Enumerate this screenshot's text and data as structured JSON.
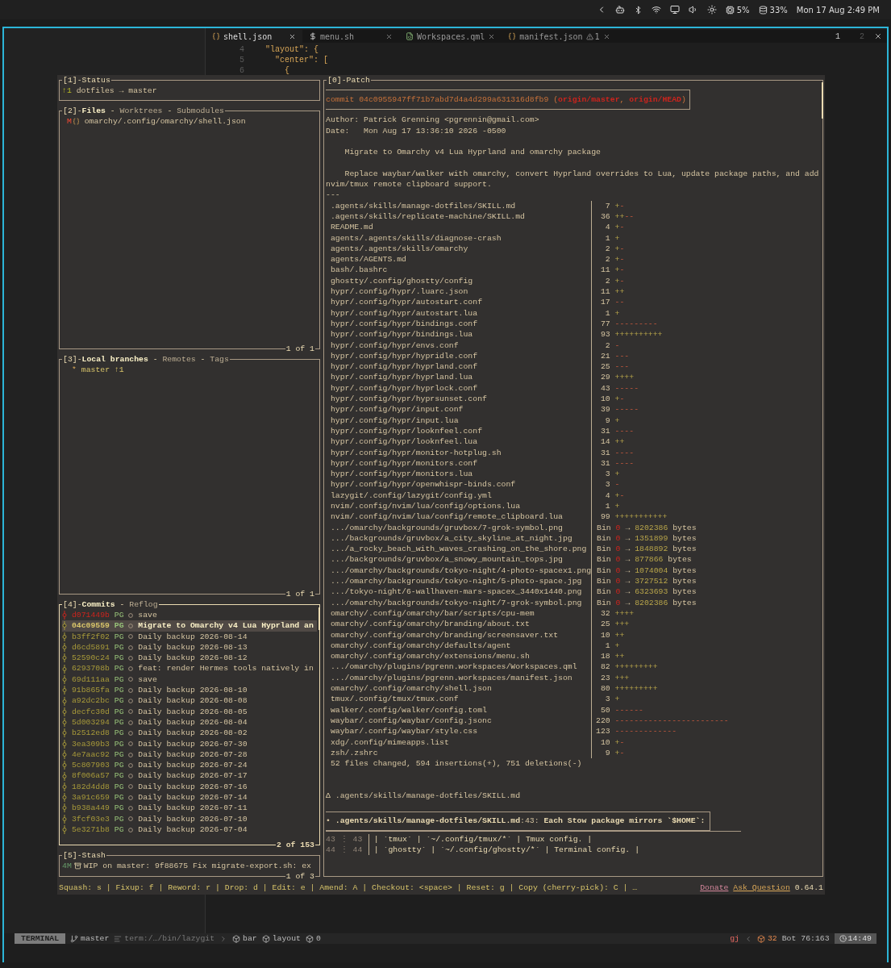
{
  "top_bar": {
    "cpu": "5%",
    "memory": "33%",
    "clock": "Mon 17 Aug 2:49 PM"
  },
  "editor": {
    "tabs": [
      {
        "label": "shell.json",
        "kind": "json",
        "selected": true
      },
      {
        "label": "menu.sh",
        "kind": "shell",
        "selected": false
      },
      {
        "label": "Workspaces.qml",
        "kind": "qml",
        "selected": false
      },
      {
        "label": "manifest.json",
        "kind": "json",
        "selected": false,
        "warnings": "1"
      }
    ],
    "tabpages": [
      {
        "label": "1",
        "selected": true
      },
      {
        "label": "2",
        "selected": false
      }
    ],
    "lines": [
      {
        "number": "4",
        "text": "  \"layout\": {"
      },
      {
        "number": "5",
        "text": "    \"center\": ["
      },
      {
        "number": "6",
        "text": "      {"
      }
    ]
  },
  "lazygit": {
    "status": {
      "title": "[1]-Status",
      "ahead": "↑1",
      "repo": "dotfiles → master"
    },
    "files": {
      "prefix": "[2]-",
      "separator": " - ",
      "tabs": [
        {
          "label": "Files",
          "selected": true
        },
        {
          "label": "Worktrees",
          "selected": false
        },
        {
          "label": "Submodules",
          "selected": false
        }
      ],
      "rows": [
        {
          "status": "M",
          "path": "omarchy/.config/omarchy/shell.json"
        }
      ],
      "footer": "1 of 1"
    },
    "branches": {
      "prefix": "[3]-",
      "separator": " - ",
      "tabs": [
        {
          "label": "Local branches",
          "selected": true
        },
        {
          "label": "Remotes",
          "selected": false
        },
        {
          "label": "Tags",
          "selected": false
        }
      ],
      "rows": [
        {
          "marker": "*",
          "name": "master",
          "ahead": "↑1"
        }
      ],
      "footer": "1 of 1"
    },
    "commits": {
      "prefix": "[4]-",
      "separator": " - ",
      "focused": true,
      "tabs": [
        {
          "label": "Commits",
          "selected": true
        },
        {
          "label": "Reflog",
          "selected": false
        }
      ],
      "rows": [
        {
          "hash": "d071449b",
          "author": "PG",
          "message": "save",
          "pushed": false,
          "selected": false
        },
        {
          "hash": "04c09559",
          "author": "PG",
          "message": "Migrate to Omarchy v4 Lua Hyprland an",
          "pushed": true,
          "selected": true
        },
        {
          "hash": "b3ff2f02",
          "author": "PG",
          "message": "Daily backup 2026-08-14",
          "pushed": true,
          "selected": false
        },
        {
          "hash": "d6cd5891",
          "author": "PG",
          "message": "Daily backup 2026-08-13",
          "pushed": true,
          "selected": false
        },
        {
          "hash": "52590c24",
          "author": "PG",
          "message": "Daily backup 2026-08-12",
          "pushed": true,
          "selected": false
        },
        {
          "hash": "6293708b",
          "author": "PG",
          "message": "feat: render Hermes tools natively in",
          "pushed": true,
          "selected": false
        },
        {
          "hash": "69d111aa",
          "author": "PG",
          "message": "save",
          "pushed": true,
          "selected": false
        },
        {
          "hash": "91b865fa",
          "author": "PG",
          "message": "Daily backup 2026-08-10",
          "pushed": true,
          "selected": false
        },
        {
          "hash": "a92dc2bc",
          "author": "PG",
          "message": "Daily backup 2026-08-08",
          "pushed": true,
          "selected": false
        },
        {
          "hash": "decfc30d",
          "author": "PG",
          "message": "Daily backup 2026-08-05",
          "pushed": true,
          "selected": false
        },
        {
          "hash": "5d003294",
          "author": "PG",
          "message": "Daily backup 2026-08-04",
          "pushed": true,
          "selected": false
        },
        {
          "hash": "b2512ed8",
          "author": "PG",
          "message": "Daily backup 2026-08-02",
          "pushed": true,
          "selected": false
        },
        {
          "hash": "3ea309b3",
          "author": "PG",
          "message": "Daily backup 2026-07-30",
          "pushed": true,
          "selected": false
        },
        {
          "hash": "4e7aac92",
          "author": "PG",
          "message": "Daily backup 2026-07-28",
          "pushed": true,
          "selected": false
        },
        {
          "hash": "5c807903",
          "author": "PG",
          "message": "Daily backup 2026-07-24",
          "pushed": true,
          "selected": false
        },
        {
          "hash": "8f006a57",
          "author": "PG",
          "message": "Daily backup 2026-07-17",
          "pushed": true,
          "selected": false
        },
        {
          "hash": "182d4dd8",
          "author": "PG",
          "message": "Daily backup 2026-07-16",
          "pushed": true,
          "selected": false
        },
        {
          "hash": "3a91c659",
          "author": "PG",
          "message": "Daily backup 2026-07-14",
          "pushed": true,
          "selected": false
        },
        {
          "hash": "b938a449",
          "author": "PG",
          "message": "Daily backup 2026-07-11",
          "pushed": true,
          "selected": false
        },
        {
          "hash": "3fcf03e3",
          "author": "PG",
          "message": "Daily backup 2026-07-10",
          "pushed": true,
          "selected": false
        },
        {
          "hash": "5e3271b8",
          "author": "PG",
          "message": "Daily backup 2026-07-04",
          "pushed": true,
          "selected": false
        }
      ],
      "footer": "2 of 153"
    },
    "stash": {
      "title": "[5]-Stash",
      "rows": [
        {
          "count": "4M",
          "text": "WIP on master: 9f88675 Fix migrate-export.sh: ex"
        }
      ],
      "footer": "1 of 3"
    },
    "patch": {
      "title": "[0]-Patch",
      "commit_line": "commit 04c0955947ff71b7abd7d4a4d299a631316d8fb9 (**origin/master**, **origin/HEAD**)",
      "author": "Author: Patrick Grenning <pgrennin@gmail.com>",
      "date": "Date:   Mon Aug 17 13:36:10 2026 -0500",
      "subject": "Migrate to Omarchy v4 Lua Hyprland and omarchy package",
      "body": "Replace waybar/walker with omarchy, convert Hyprland overrides to Lua, update package paths, and add nvim/tmux remote clipboard support.",
      "separator": "---",
      "diffstat": [
        {
          "kind": "text",
          "path": ".agents/skills/manage-dotfiles/SKILL.md",
          "changes": "7",
          "plus": "+",
          "minus": "-"
        },
        {
          "kind": "text",
          "path": ".agents/skills/replicate-machine/SKILL.md",
          "changes": "36",
          "plus": "++",
          "minus": "--"
        },
        {
          "kind": "text",
          "path": "README.md",
          "changes": "4",
          "plus": "+",
          "minus": "-"
        },
        {
          "kind": "text",
          "path": "agents/.agents/skills/diagnose-crash",
          "changes": "1",
          "plus": "+"
        },
        {
          "kind": "text",
          "path": "agents/.agents/skills/omarchy",
          "changes": "2",
          "plus": "+",
          "minus": "-"
        },
        {
          "kind": "text",
          "path": "agents/AGENTS.md",
          "changes": "2",
          "plus": "+",
          "minus": "-"
        },
        {
          "kind": "text",
          "path": "bash/.bashrc",
          "changes": "11",
          "plus": "+",
          "minus": "-"
        },
        {
          "kind": "text",
          "path": "ghostty/.config/ghostty/config",
          "changes": "2",
          "plus": "+",
          "minus": "-"
        },
        {
          "kind": "text",
          "path": "hypr/.config/hypr/.luarc.json",
          "changes": "11",
          "plus": "++"
        },
        {
          "kind": "text",
          "path": "hypr/.config/hypr/autostart.conf",
          "changes": "17",
          "minus": "--"
        },
        {
          "kind": "text",
          "path": "hypr/.config/hypr/autostart.lua",
          "changes": "1",
          "plus": "+"
        },
        {
          "kind": "text",
          "path": "hypr/.config/hypr/bindings.conf",
          "changes": "77",
          "minus": "---------"
        },
        {
          "kind": "text",
          "path": "hypr/.config/hypr/bindings.lua",
          "changes": "93",
          "plus": "++++++++++"
        },
        {
          "kind": "text",
          "path": "hypr/.config/hypr/envs.conf",
          "changes": "2",
          "minus": "-"
        },
        {
          "kind": "text",
          "path": "hypr/.config/hypr/hypridle.conf",
          "changes": "21",
          "minus": "---"
        },
        {
          "kind": "text",
          "path": "hypr/.config/hypr/hyprland.conf",
          "changes": "25",
          "minus": "---"
        },
        {
          "kind": "text",
          "path": "hypr/.config/hypr/hyprland.lua",
          "changes": "29",
          "plus": "++++"
        },
        {
          "kind": "text",
          "path": "hypr/.config/hypr/hyprlock.conf",
          "changes": "43",
          "minus": "-----"
        },
        {
          "kind": "text",
          "path": "hypr/.config/hypr/hyprsunset.conf",
          "changes": "10",
          "plus": "+",
          "minus": "-"
        },
        {
          "kind": "text",
          "path": "hypr/.config/hypr/input.conf",
          "changes": "39",
          "minus": "-----"
        },
        {
          "kind": "text",
          "path": "hypr/.config/hypr/input.lua",
          "changes": "9",
          "plus": "+"
        },
        {
          "kind": "text",
          "path": "hypr/.config/hypr/looknfeel.conf",
          "changes": "31",
          "minus": "----"
        },
        {
          "kind": "text",
          "path": "hypr/.config/hypr/looknfeel.lua",
          "changes": "14",
          "plus": "++"
        },
        {
          "kind": "text",
          "path": "hypr/.config/hypr/monitor-hotplug.sh",
          "changes": "31",
          "minus": "----"
        },
        {
          "kind": "text",
          "path": "hypr/.config/hypr/monitors.conf",
          "changes": "31",
          "minus": "----"
        },
        {
          "kind": "text",
          "path": "hypr/.config/hypr/monitors.lua",
          "changes": "3",
          "plus": "+"
        },
        {
          "kind": "text",
          "path": "hypr/.config/hypr/openwhispr-binds.conf",
          "changes": "3",
          "minus": "-"
        },
        {
          "kind": "text",
          "path": "lazygit/.config/lazygit/config.yml",
          "changes": "4",
          "plus": "+",
          "minus": "-"
        },
        {
          "kind": "text",
          "path": "nvim/.config/nvim/lua/config/options.lua",
          "changes": "1",
          "plus": "+"
        },
        {
          "kind": "text",
          "path": "nvim/.config/nvim/lua/config/remote_clipboard.lua",
          "changes": "99",
          "plus": "+++++++++++"
        },
        {
          "kind": "bin",
          "path": ".../omarchy/backgrounds/gruvbox/7-grok-symbol.png",
          "label": "Bin",
          "from": "0",
          "arrow": "→",
          "to": "8202386",
          "unit": "bytes"
        },
        {
          "kind": "bin",
          "path": ".../backgrounds/gruvbox/a_city_skyline_at_night.jpg",
          "label": "Bin",
          "from": "0",
          "arrow": "→",
          "to": "1351899",
          "unit": "bytes"
        },
        {
          "kind": "bin",
          "path": ".../a_rocky_beach_with_waves_crashing_on_the_shore.png",
          "label": "Bin",
          "from": "0",
          "arrow": "→",
          "to": "1848892",
          "unit": "bytes"
        },
        {
          "kind": "bin",
          "path": ".../backgrounds/gruvbox/a_snowy_mountain_tops.jpg",
          "label": "Bin",
          "from": "0",
          "arrow": "→",
          "to": "877866",
          "unit": "bytes"
        },
        {
          "kind": "bin",
          "path": ".../omarchy/backgrounds/tokyo-night/4-photo-spacex1.png",
          "label": "Bin",
          "from": "0",
          "arrow": "→",
          "to": "1074004",
          "unit": "bytes"
        },
        {
          "kind": "bin",
          "path": ".../omarchy/backgrounds/tokyo-night/5-photo-space.jpg",
          "label": "Bin",
          "from": "0",
          "arrow": "→",
          "to": "3727512",
          "unit": "bytes"
        },
        {
          "kind": "bin",
          "path": ".../tokyo-night/6-wallhaven-mars-spacex_3440x1440.png",
          "label": "Bin",
          "from": "0",
          "arrow": "→",
          "to": "6323693",
          "unit": "bytes"
        },
        {
          "kind": "bin",
          "path": ".../omarchy/backgrounds/tokyo-night/7-grok-symbol.png",
          "label": "Bin",
          "from": "0",
          "arrow": "→",
          "to": "8202386",
          "unit": "bytes"
        },
        {
          "kind": "text",
          "path": "omarchy/.config/omarchy/bar/scripts/cpu-mem",
          "changes": "32",
          "plus": "++++"
        },
        {
          "kind": "text",
          "path": "omarchy/.config/omarchy/branding/about.txt",
          "changes": "25",
          "plus": "+++"
        },
        {
          "kind": "text",
          "path": "omarchy/.config/omarchy/branding/screensaver.txt",
          "changes": "10",
          "plus": "++"
        },
        {
          "kind": "text",
          "path": "omarchy/.config/omarchy/defaults/agent",
          "changes": "1",
          "plus": "+"
        },
        {
          "kind": "text",
          "path": "omarchy/.config/omarchy/extensions/menu.sh",
          "changes": "18",
          "plus": "++"
        },
        {
          "kind": "text",
          "path": ".../omarchy/plugins/pgrenn.workspaces/Workspaces.qml",
          "changes": "82",
          "plus": "+++++++++"
        },
        {
          "kind": "text",
          "path": ".../omarchy/plugins/pgrenn.workspaces/manifest.json",
          "changes": "23",
          "plus": "+++"
        },
        {
          "kind": "text",
          "path": "omarchy/.config/omarchy/shell.json",
          "changes": "80",
          "plus": "+++++++++"
        },
        {
          "kind": "text",
          "path": "tmux/.config/tmux/tmux.conf",
          "changes": "3",
          "plus": "+"
        },
        {
          "kind": "text",
          "path": "walker/.config/walker/config.toml",
          "changes": "50",
          "minus": "------"
        },
        {
          "kind": "text",
          "path": "waybar/.config/waybar/config.jsonc",
          "changes": "220",
          "minus": "------------------------"
        },
        {
          "kind": "text",
          "path": "waybar/.config/waybar/style.css",
          "changes": "123",
          "minus": "-------------"
        },
        {
          "kind": "text",
          "path": "xdg/.config/mimeapps.list",
          "changes": "10",
          "plus": "+",
          "minus": "-"
        },
        {
          "kind": "text",
          "path": "zsh/.zshrc",
          "changes": "9",
          "plus": "+",
          "minus": "-"
        }
      ],
      "summary": "52 files changed, 594 insertions(+), 751 deletions(-)",
      "delta_file": "Δ .agents/skills/manage-dotfiles/SKILL.md",
      "hunk": "• **.agents/skills/manage-dotfiles/SKILL.md**:43: **Each Stow package mirrors `$HOME`:**",
      "hunk_lines": [
        {
          "old": "43",
          "sep": "⋮",
          "new": "43",
          "text": "| `tmux` | `~/.config/tmux/*` | Tmux config. |"
        },
        {
          "old": "44",
          "sep": "⋮",
          "new": "44",
          "text": "| `ghostty` | `~/.config/ghostty/*` | Terminal config. |"
        }
      ]
    },
    "options": {
      "text": "Squash: s | Fixup: f | Reword: r | Drop: d | Edit: e | Amend: A | Checkout: <space> | Reset: g | Copy (cherry-pick): C | …",
      "links": [
        "Donate",
        "Ask Question"
      ],
      "version": "0.64.1"
    }
  },
  "statusline": {
    "mode": "TERMINAL",
    "branch": "master",
    "path": "term:/…/bin/lazygit",
    "symbols": [
      "bar",
      "layout",
      "0"
    ],
    "keys": "gj",
    "count": "32",
    "position": "Bot",
    "cursor": "76:163",
    "time": "14:49"
  }
}
